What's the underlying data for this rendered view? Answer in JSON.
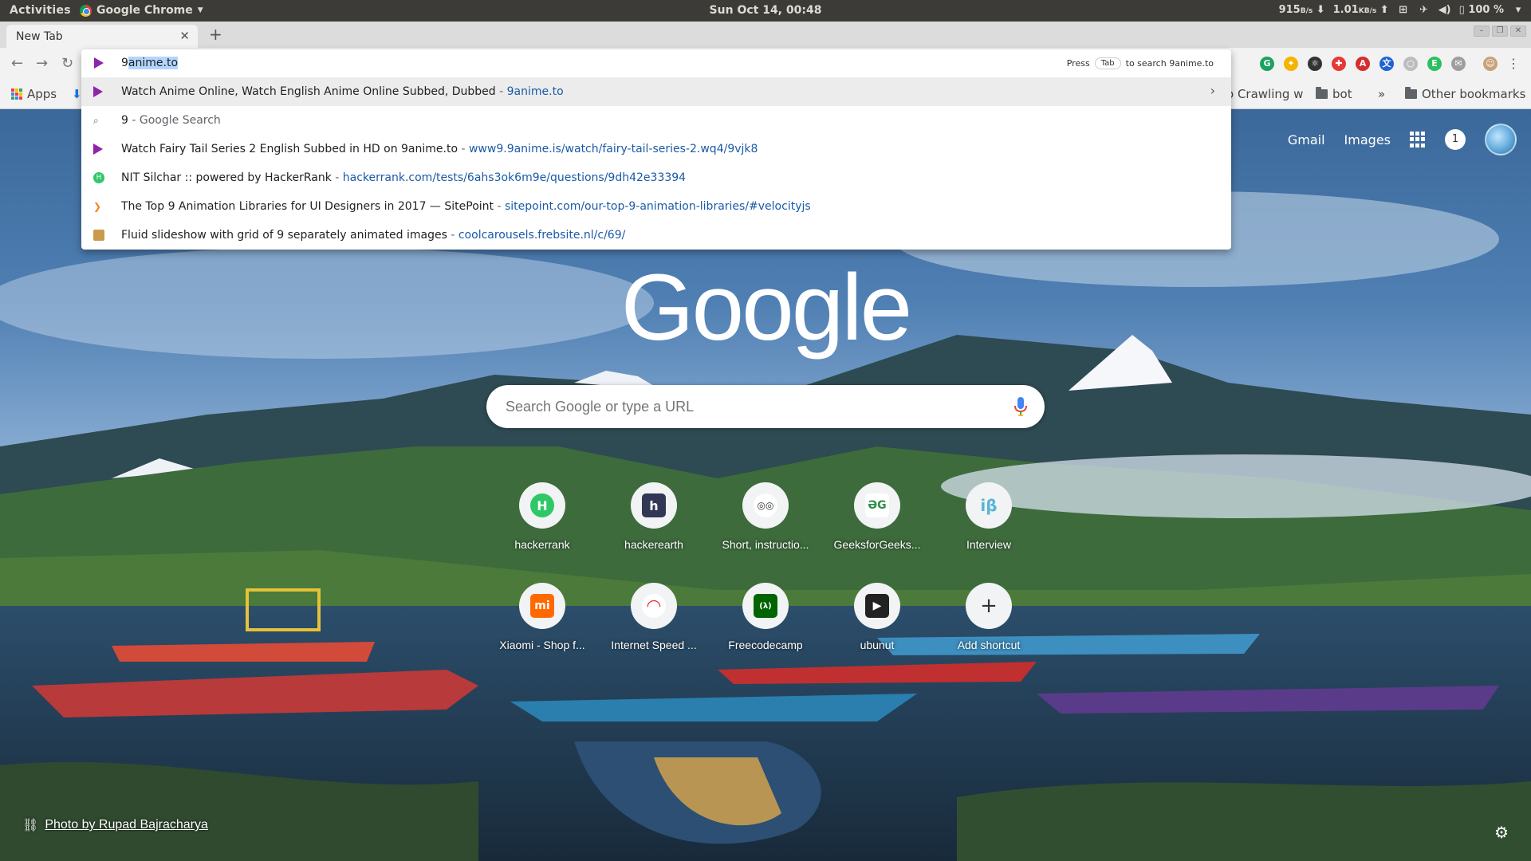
{
  "system_bar": {
    "activities": "Activities",
    "app_name": "Google Chrome",
    "clock": "Sun Oct 14, 00:48",
    "net_down_value": "915",
    "net_down_unit": "B/s",
    "net_up_value": "1.01",
    "net_up_unit": "KB/s",
    "battery": "100 %"
  },
  "tabs": [
    {
      "title": "New Tab"
    }
  ],
  "omnibox": {
    "typed_prefix": "9",
    "autocomplete_selected": "anime.to",
    "hint_press": "Press",
    "hint_key": "Tab",
    "hint_suffix": "to search 9anime.to",
    "suggestions": [
      {
        "title": "Watch Anime Online, Watch English Anime Online Subbed, Dubbed",
        "sep": " - ",
        "url": "9anime.to",
        "icon": "play-icon"
      },
      {
        "title": "9",
        "sep": " - ",
        "url": "Google Search",
        "icon": "search-icon"
      },
      {
        "title": "Watch Fairy Tail Series 2 English Subbed in HD on 9anime.to",
        "sep": " - ",
        "url": "www9.9anime.is/watch/fairy-tail-series-2.wq4/9vjk8",
        "icon": "play-icon"
      },
      {
        "title": "NIT Silchar :: powered by HackerRank",
        "sep": " - ",
        "url": "hackerrank.com/tests/6ahs3ok6m9e/questions/9dh42e33394",
        "icon": "hackerrank-icon"
      },
      {
        "title": "The Top 9 Animation Libraries for UI Designers in 2017 — SitePoint",
        "sep": " - ",
        "url": "sitepoint.com/our-top-9-animation-libraries/#velocityjs",
        "icon": "sitepoint-icon"
      },
      {
        "title": "Fluid slideshow with grid of 9 separately animated images",
        "sep": " - ",
        "url": "coolcarousels.frebsite.nl/c/69/",
        "icon": "carousel-icon"
      }
    ]
  },
  "bookmarks_bar": {
    "apps": "Apps",
    "crawling": "o Crawling w",
    "bot": "bot",
    "overflow": "»",
    "other": "Other bookmarks"
  },
  "ntp": {
    "gmail": "Gmail",
    "images": "Images",
    "notifications": "1",
    "logo": "Google",
    "search_placeholder": "Search Google or type a URL",
    "shortcuts": [
      {
        "label": "hackerrank",
        "icon": "hackerrank-icon",
        "color": "#2ec866",
        "glyph": "H"
      },
      {
        "label": "hackerearth",
        "icon": "hackerearth-icon",
        "color": "#323754",
        "glyph": "h"
      },
      {
        "label": "Short, instructio...",
        "icon": "glasses-icon",
        "color": "#ffffff",
        "glyph": "◎◎"
      },
      {
        "label": "GeeksforGeeks...",
        "icon": "geeksforgeeks-icon",
        "color": "#ffffff",
        "glyph": "ƏG"
      },
      {
        "label": "Interview",
        "icon": "interviewbit-icon",
        "color": "#ffffff",
        "glyph": "iβ"
      },
      {
        "label": "Xiaomi - Shop f...",
        "icon": "xiaomi-icon",
        "color": "#ff6900",
        "glyph": "mi"
      },
      {
        "label": "Internet Speed ...",
        "icon": "speedtest-icon",
        "color": "#ffffff",
        "glyph": "◠"
      },
      {
        "label": "Freecodecamp",
        "icon": "freecodecamp-icon",
        "color": "#006400",
        "glyph": "(λ)"
      },
      {
        "label": "ubunut",
        "icon": "terminal-icon",
        "color": "#222222",
        "glyph": "▶"
      },
      {
        "label": "Add shortcut",
        "icon": "plus-icon",
        "color": "#ffffff",
        "glyph": "+"
      }
    ],
    "photo_credit": "Photo by Rupad Bajracharya"
  }
}
